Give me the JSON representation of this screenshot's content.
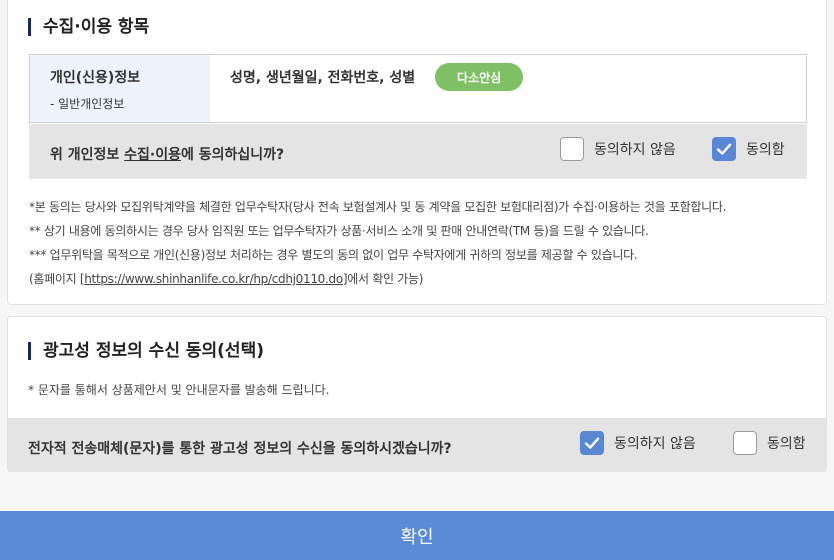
{
  "section1": {
    "title": "수집·이용 항목",
    "table": {
      "head_main": "개인(신용)정보",
      "head_sub": "- 일반개인정보",
      "items": "성명, 생년월일, 전화번호, 성별",
      "badge": "다소안심"
    },
    "question_pre": "위 개인정보 ",
    "question_link": "수집·이용",
    "question_post": "에 동의하십니까?",
    "option_no": "동의하지 않음",
    "option_yes": "동의함",
    "option_no_checked": false,
    "option_yes_checked": true,
    "notes": {
      "n1": "*본 동의는 당사와 모집위탁계약을 체결한 업무수탁자(당사 전속 보험설계사 및 동 계약을 모집한 보험대리점)가 수집·이용하는 것을 포함합니다.",
      "n2": "** 상기 내용에 동의하시는 경우 당사 임직원 또는 업무수탁자가 상품·서비스 소개 및 판매 안내연락(TM 등)을 드릴 수 있습니다.",
      "n3": "*** 업무위탁을 목적으로 개인(신용)정보 처리하는 경우 별도의 동의 없이 업무 수탁자에게 귀하의 정보를 제공할 수 있습니다.",
      "n4_pre": "(홈페이지 [",
      "n4_link": "https://www.shinhanlife.co.kr/hp/cdhj0110.do",
      "n4_post": "]에서 확인 가능)"
    }
  },
  "section2": {
    "title": "광고성 정보의 수신 동의(선택)",
    "note": "* 문자를 통해서 상품제안서 및 안내문자를 발송해 드립니다.",
    "question": "전자적 전송매체(문자)를 통한 광고성 정보의 수신을 동의하시겠습니까?",
    "option_no": "동의하지 않음",
    "option_yes": "동의함",
    "option_no_checked": true,
    "option_yes_checked": false
  },
  "confirm_label": "확인",
  "colors": {
    "accent": "#5b8ad6",
    "badge": "#80c065",
    "title_bar": "#1b2b5f"
  }
}
